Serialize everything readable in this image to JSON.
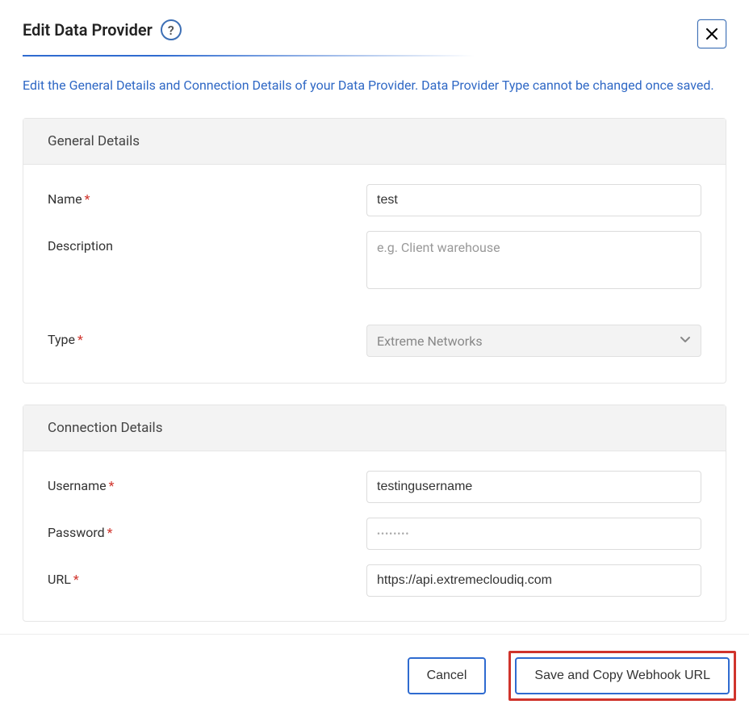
{
  "dialog": {
    "title": "Edit Data Provider",
    "info": "Edit the General Details and Connection Details of your Data Provider. Data Provider Type cannot be changed once saved."
  },
  "sections": {
    "general": {
      "title": "General Details",
      "fields": {
        "name": {
          "label": "Name",
          "value": "test"
        },
        "description": {
          "label": "Description",
          "placeholder": "e.g. Client warehouse",
          "value": ""
        },
        "type": {
          "label": "Type",
          "value": "Extreme Networks"
        }
      }
    },
    "connection": {
      "title": "Connection Details",
      "fields": {
        "username": {
          "label": "Username",
          "value": "testingusername"
        },
        "password": {
          "label": "Password",
          "value": "••••••••"
        },
        "url": {
          "label": "URL",
          "value": "https://api.extremecloudiq.com"
        }
      }
    }
  },
  "footer": {
    "cancel": "Cancel",
    "save": "Save and Copy Webhook URL"
  }
}
